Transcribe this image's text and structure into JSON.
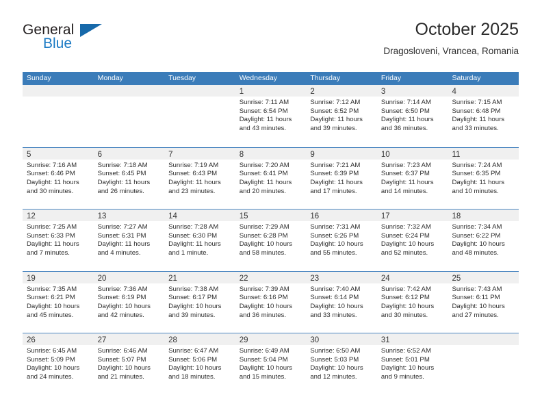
{
  "brand": {
    "name_part1": "General",
    "name_part2": "Blue",
    "triangle_color": "#1769aa",
    "blue_color": "#1b7ac4"
  },
  "header": {
    "title": "October 2025",
    "subtitle": "Dragosloveni, Vrancea, Romania"
  },
  "theme": {
    "header_blue": "#3b7cb9",
    "row_divider": "#4a86c0",
    "daynum_strip": "#f0f0f0",
    "text": "#2b2b2b"
  },
  "weekdays": [
    "Sunday",
    "Monday",
    "Tuesday",
    "Wednesday",
    "Thursday",
    "Friday",
    "Saturday"
  ],
  "labels": {
    "sunrise_prefix": "Sunrise:",
    "sunset_prefix": "Sunset:",
    "daylight_prefix": "Daylight:"
  },
  "weeks": [
    [
      {
        "day": "",
        "empty": true
      },
      {
        "day": "",
        "empty": true
      },
      {
        "day": "",
        "empty": true
      },
      {
        "day": "1",
        "sunrise": "Sunrise: 7:11 AM",
        "sunset": "Sunset: 6:54 PM",
        "daylight": "Daylight: 11 hours and 43 minutes."
      },
      {
        "day": "2",
        "sunrise": "Sunrise: 7:12 AM",
        "sunset": "Sunset: 6:52 PM",
        "daylight": "Daylight: 11 hours and 39 minutes."
      },
      {
        "day": "3",
        "sunrise": "Sunrise: 7:14 AM",
        "sunset": "Sunset: 6:50 PM",
        "daylight": "Daylight: 11 hours and 36 minutes."
      },
      {
        "day": "4",
        "sunrise": "Sunrise: 7:15 AM",
        "sunset": "Sunset: 6:48 PM",
        "daylight": "Daylight: 11 hours and 33 minutes."
      }
    ],
    [
      {
        "day": "5",
        "sunrise": "Sunrise: 7:16 AM",
        "sunset": "Sunset: 6:46 PM",
        "daylight": "Daylight: 11 hours and 30 minutes."
      },
      {
        "day": "6",
        "sunrise": "Sunrise: 7:18 AM",
        "sunset": "Sunset: 6:45 PM",
        "daylight": "Daylight: 11 hours and 26 minutes."
      },
      {
        "day": "7",
        "sunrise": "Sunrise: 7:19 AM",
        "sunset": "Sunset: 6:43 PM",
        "daylight": "Daylight: 11 hours and 23 minutes."
      },
      {
        "day": "8",
        "sunrise": "Sunrise: 7:20 AM",
        "sunset": "Sunset: 6:41 PM",
        "daylight": "Daylight: 11 hours and 20 minutes."
      },
      {
        "day": "9",
        "sunrise": "Sunrise: 7:21 AM",
        "sunset": "Sunset: 6:39 PM",
        "daylight": "Daylight: 11 hours and 17 minutes."
      },
      {
        "day": "10",
        "sunrise": "Sunrise: 7:23 AM",
        "sunset": "Sunset: 6:37 PM",
        "daylight": "Daylight: 11 hours and 14 minutes."
      },
      {
        "day": "11",
        "sunrise": "Sunrise: 7:24 AM",
        "sunset": "Sunset: 6:35 PM",
        "daylight": "Daylight: 11 hours and 10 minutes."
      }
    ],
    [
      {
        "day": "12",
        "sunrise": "Sunrise: 7:25 AM",
        "sunset": "Sunset: 6:33 PM",
        "daylight": "Daylight: 11 hours and 7 minutes."
      },
      {
        "day": "13",
        "sunrise": "Sunrise: 7:27 AM",
        "sunset": "Sunset: 6:31 PM",
        "daylight": "Daylight: 11 hours and 4 minutes."
      },
      {
        "day": "14",
        "sunrise": "Sunrise: 7:28 AM",
        "sunset": "Sunset: 6:30 PM",
        "daylight": "Daylight: 11 hours and 1 minute."
      },
      {
        "day": "15",
        "sunrise": "Sunrise: 7:29 AM",
        "sunset": "Sunset: 6:28 PM",
        "daylight": "Daylight: 10 hours and 58 minutes."
      },
      {
        "day": "16",
        "sunrise": "Sunrise: 7:31 AM",
        "sunset": "Sunset: 6:26 PM",
        "daylight": "Daylight: 10 hours and 55 minutes."
      },
      {
        "day": "17",
        "sunrise": "Sunrise: 7:32 AM",
        "sunset": "Sunset: 6:24 PM",
        "daylight": "Daylight: 10 hours and 52 minutes."
      },
      {
        "day": "18",
        "sunrise": "Sunrise: 7:34 AM",
        "sunset": "Sunset: 6:22 PM",
        "daylight": "Daylight: 10 hours and 48 minutes."
      }
    ],
    [
      {
        "day": "19",
        "sunrise": "Sunrise: 7:35 AM",
        "sunset": "Sunset: 6:21 PM",
        "daylight": "Daylight: 10 hours and 45 minutes."
      },
      {
        "day": "20",
        "sunrise": "Sunrise: 7:36 AM",
        "sunset": "Sunset: 6:19 PM",
        "daylight": "Daylight: 10 hours and 42 minutes."
      },
      {
        "day": "21",
        "sunrise": "Sunrise: 7:38 AM",
        "sunset": "Sunset: 6:17 PM",
        "daylight": "Daylight: 10 hours and 39 minutes."
      },
      {
        "day": "22",
        "sunrise": "Sunrise: 7:39 AM",
        "sunset": "Sunset: 6:16 PM",
        "daylight": "Daylight: 10 hours and 36 minutes."
      },
      {
        "day": "23",
        "sunrise": "Sunrise: 7:40 AM",
        "sunset": "Sunset: 6:14 PM",
        "daylight": "Daylight: 10 hours and 33 minutes."
      },
      {
        "day": "24",
        "sunrise": "Sunrise: 7:42 AM",
        "sunset": "Sunset: 6:12 PM",
        "daylight": "Daylight: 10 hours and 30 minutes."
      },
      {
        "day": "25",
        "sunrise": "Sunrise: 7:43 AM",
        "sunset": "Sunset: 6:11 PM",
        "daylight": "Daylight: 10 hours and 27 minutes."
      }
    ],
    [
      {
        "day": "26",
        "sunrise": "Sunrise: 6:45 AM",
        "sunset": "Sunset: 5:09 PM",
        "daylight": "Daylight: 10 hours and 24 minutes."
      },
      {
        "day": "27",
        "sunrise": "Sunrise: 6:46 AM",
        "sunset": "Sunset: 5:07 PM",
        "daylight": "Daylight: 10 hours and 21 minutes."
      },
      {
        "day": "28",
        "sunrise": "Sunrise: 6:47 AM",
        "sunset": "Sunset: 5:06 PM",
        "daylight": "Daylight: 10 hours and 18 minutes."
      },
      {
        "day": "29",
        "sunrise": "Sunrise: 6:49 AM",
        "sunset": "Sunset: 5:04 PM",
        "daylight": "Daylight: 10 hours and 15 minutes."
      },
      {
        "day": "30",
        "sunrise": "Sunrise: 6:50 AM",
        "sunset": "Sunset: 5:03 PM",
        "daylight": "Daylight: 10 hours and 12 minutes."
      },
      {
        "day": "31",
        "sunrise": "Sunrise: 6:52 AM",
        "sunset": "Sunset: 5:01 PM",
        "daylight": "Daylight: 10 hours and 9 minutes."
      },
      {
        "day": "",
        "empty": true
      }
    ]
  ]
}
